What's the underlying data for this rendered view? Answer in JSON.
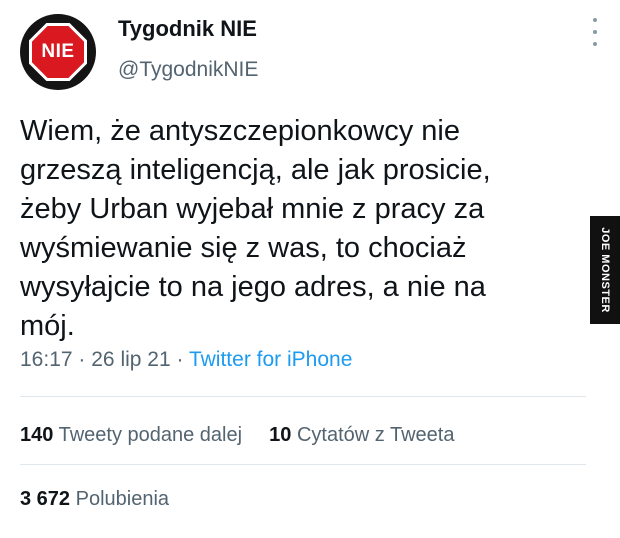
{
  "author": {
    "avatar_text": "NIE",
    "name": "Tygodnik NIE",
    "handle": "@TygodnikNIE"
  },
  "tweet": {
    "lines": [
      "Wiem, że antyszczepionkowcy nie",
      "grzeszą inteligencją, ale jak prosicie,",
      "żeby Urban wyjebał mnie z pracy za",
      "wyśmiewanie się z was, to chociaż",
      "wysyłajcie to na jego adres, a nie na",
      "mój."
    ],
    "time": "16:17",
    "date": "26 lip 21",
    "separator": "·",
    "source": "Twitter for iPhone"
  },
  "stats": {
    "retweets_count": "140",
    "retweets_label": "Tweety podane dalej",
    "quotes_count": "10",
    "quotes_label": "Cytatów z Tweeta",
    "likes_count": "3 672",
    "likes_label": "Polubienia"
  },
  "watermark": {
    "text": "JOE MONSTER"
  },
  "colors": {
    "link": "#1d9bf0",
    "secondary_text": "#536471",
    "logo_red": "#d9181f"
  },
  "icons": {
    "more": "more-vertical-icon"
  }
}
